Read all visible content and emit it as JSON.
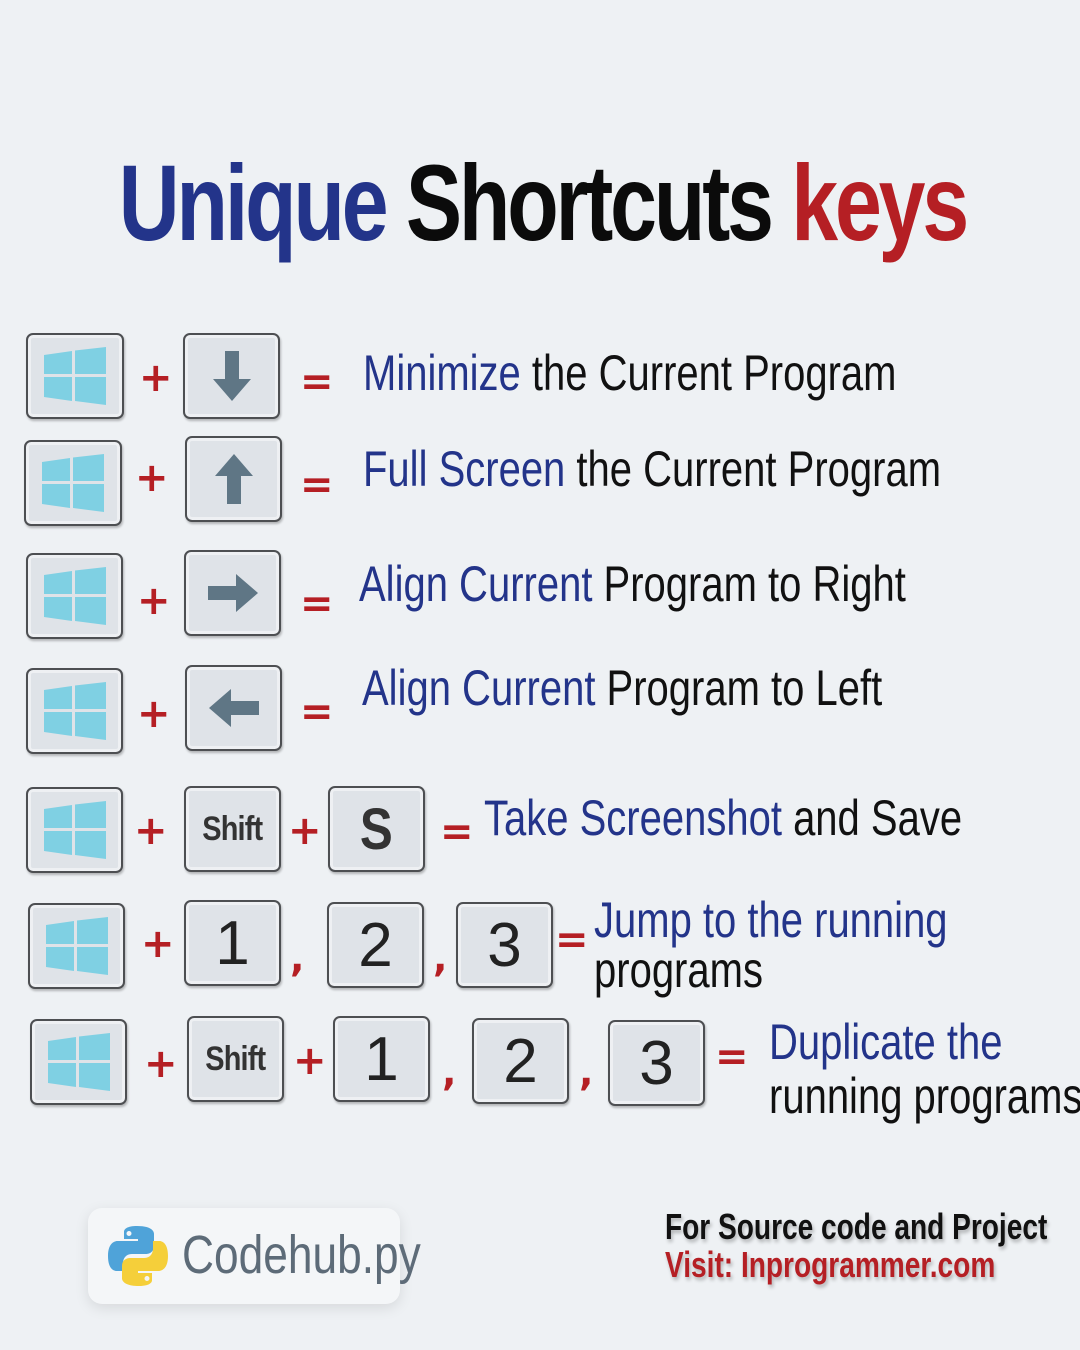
{
  "title": {
    "part1": "Unique",
    "part2": "Shortcuts",
    "part3": "keys"
  },
  "operators": {
    "plus": "+",
    "equals": "=",
    "comma": ","
  },
  "keys": {
    "shift": "Shift",
    "s": "S",
    "one": "1",
    "two": "2",
    "three": "3"
  },
  "rows": [
    {
      "hl": "Minimize",
      "rest": " the Current Program"
    },
    {
      "hl": "Full Screen",
      "rest": " the Current Program"
    },
    {
      "hl": "Align Current",
      "rest": " Program to Right"
    },
    {
      "hl": "Align Current",
      "rest": " Program to Left"
    },
    {
      "hl": "Take Screenshot",
      "rest": " and Save"
    },
    {
      "hl": "Jump to the running",
      "rest": "programs"
    },
    {
      "hl": "Duplicate the",
      "rest": "running programs"
    }
  ],
  "footer": {
    "brand": "Codehub.py",
    "line1": "For Source code and Project",
    "line2": "Visit: Inprogrammer.com"
  },
  "colors": {
    "accent_blue": "#23348a",
    "accent_red": "#b51f24",
    "win_logo": "#7fd0e3",
    "arrow": "#5f7685"
  },
  "icons": [
    "windows-logo-icon",
    "arrow-down-icon",
    "arrow-up-icon",
    "arrow-right-icon",
    "arrow-left-icon",
    "python-logo-icon"
  ]
}
